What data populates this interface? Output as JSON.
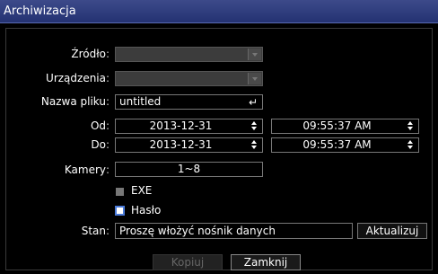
{
  "window": {
    "title": "Archiwizacja"
  },
  "form": {
    "source": {
      "label": "Źródło",
      "value": ""
    },
    "devices": {
      "label": "Urządzenia",
      "value": ""
    },
    "filename": {
      "label": "Nazwa pliku",
      "value": "untitled",
      "enter_glyph": "↵"
    },
    "from": {
      "label": "Od",
      "date": "2013-12-31",
      "time": "09:55:37 AM"
    },
    "to": {
      "label": "Do",
      "date": "2013-12-31",
      "time": "09:55:37 AM"
    },
    "cameras": {
      "label": "Kamery",
      "value": "1~8"
    },
    "exe": {
      "label": "EXE",
      "checked": false,
      "enabled": false
    },
    "password": {
      "label": "Hasło",
      "checked": false,
      "enabled": true
    },
    "status": {
      "label": "Stan",
      "value": "Proszę włożyć nośnik danych",
      "refresh_label": "Aktualizuj"
    },
    "colon": ":"
  },
  "buttons": {
    "copy": "Kopiuj",
    "close": "Zamknij"
  },
  "colors": {
    "titlebar": "#2d3a7c",
    "checkbox_accent": "#4a7ad8",
    "disabled_field": "#3c3c3c"
  }
}
